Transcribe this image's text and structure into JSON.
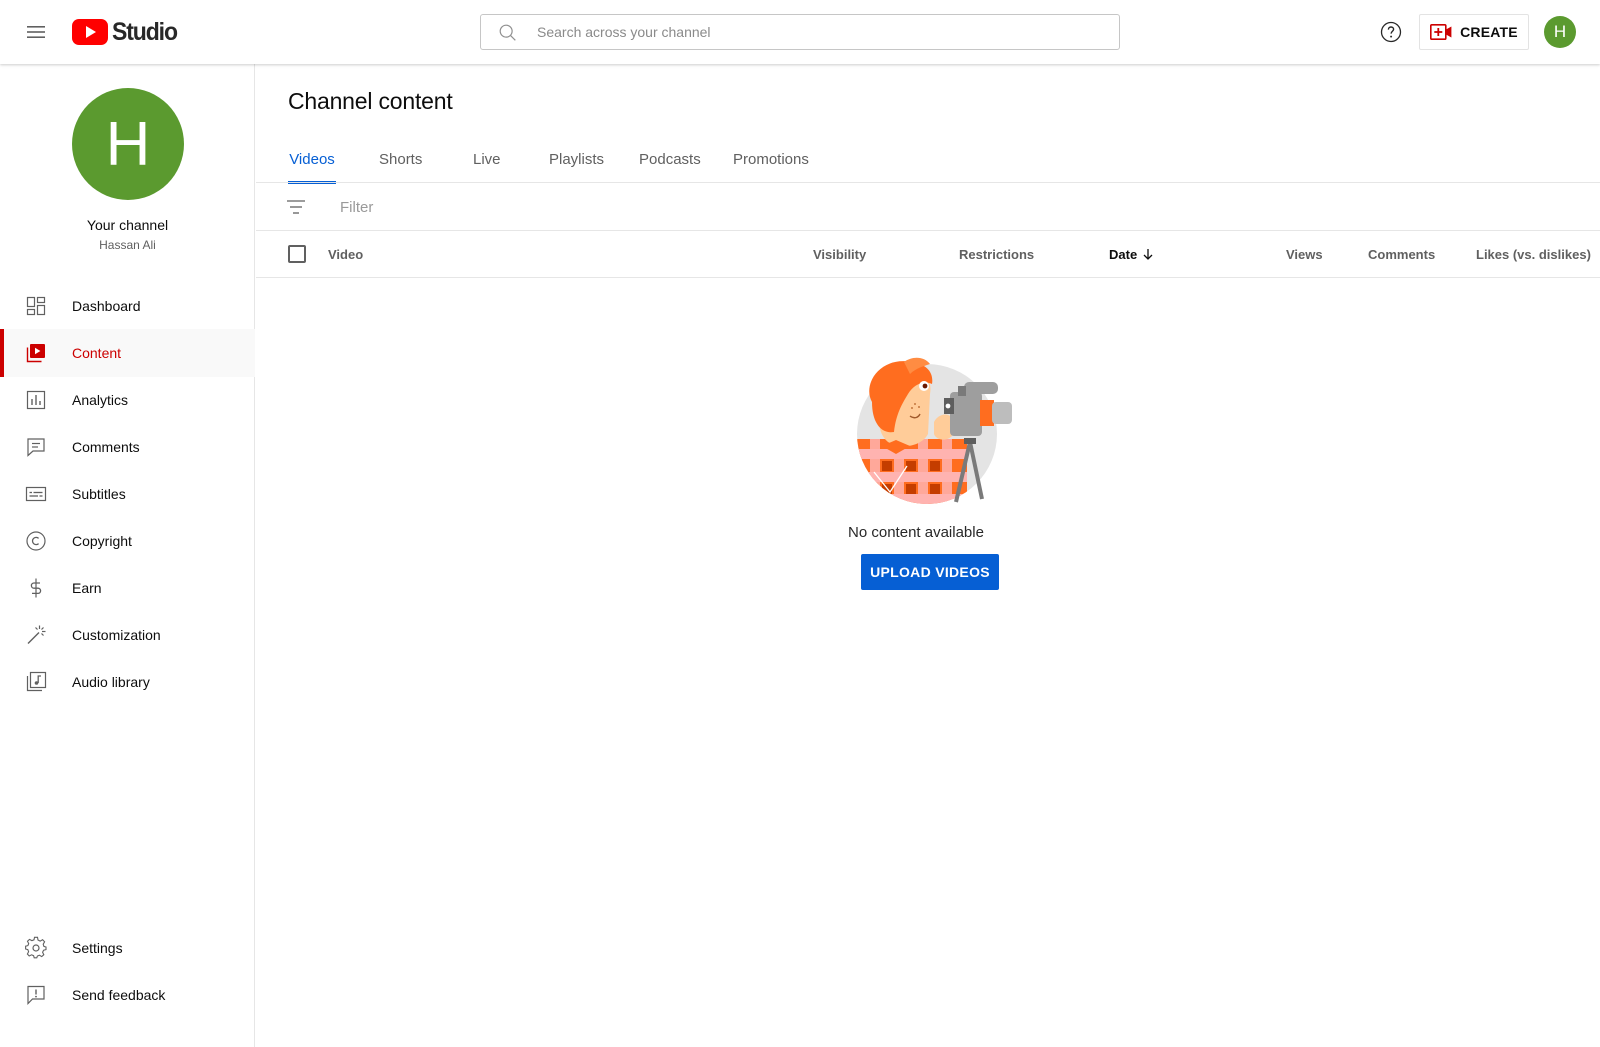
{
  "header": {
    "logo_text": "Studio",
    "search_placeholder": "Search across your channel",
    "create_label": "CREATE",
    "avatar_letter": "H",
    "brand_red": "#ff0000",
    "accent_blue": "#065fd4"
  },
  "sidebar": {
    "avatar_letter": "H",
    "avatar_color": "#5b9a2f",
    "your_channel": "Your channel",
    "channel_name": "Hassan Ali",
    "items": [
      {
        "label": "Dashboard",
        "icon": "dashboard-icon"
      },
      {
        "label": "Content",
        "icon": "content-icon",
        "active": true
      },
      {
        "label": "Analytics",
        "icon": "analytics-icon"
      },
      {
        "label": "Comments",
        "icon": "comments-icon"
      },
      {
        "label": "Subtitles",
        "icon": "subtitles-icon"
      },
      {
        "label": "Copyright",
        "icon": "copyright-icon"
      },
      {
        "label": "Earn",
        "icon": "dollar-icon"
      },
      {
        "label": "Customization",
        "icon": "magic-wand-icon"
      },
      {
        "label": "Audio library",
        "icon": "audio-library-icon"
      }
    ],
    "bottom_items": [
      {
        "label": "Settings",
        "icon": "gear-icon"
      },
      {
        "label": "Send feedback",
        "icon": "feedback-icon"
      }
    ]
  },
  "main": {
    "title": "Channel content",
    "tabs": [
      {
        "label": "Videos",
        "active": true
      },
      {
        "label": "Shorts"
      },
      {
        "label": "Live"
      },
      {
        "label": "Playlists"
      },
      {
        "label": "Podcasts"
      },
      {
        "label": "Promotions"
      }
    ],
    "filter_placeholder": "Filter",
    "columns": {
      "video": "Video",
      "visibility": "Visibility",
      "restrictions": "Restrictions",
      "date": "Date",
      "views": "Views",
      "comments": "Comments",
      "likes": "Likes (vs. dislikes)"
    },
    "empty_text": "No content available",
    "upload_label": "UPLOAD VIDEOS"
  }
}
